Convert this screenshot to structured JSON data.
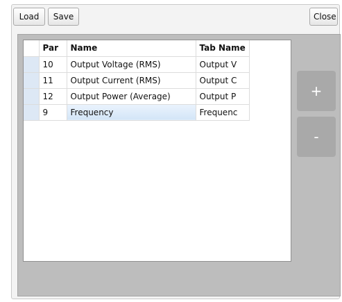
{
  "toolbar": {
    "load_label": "Load",
    "save_label": "Save",
    "close_label": "Close"
  },
  "grid": {
    "columns": [
      "Par",
      "Name",
      "Tab Name"
    ],
    "rows": [
      {
        "par": "10",
        "name": "Output Voltage (RMS)",
        "tab_name": "Output V"
      },
      {
        "par": "11",
        "name": "Output Current (RMS)",
        "tab_name": "Output C"
      },
      {
        "par": "12",
        "name": "Output Power (Average)",
        "tab_name": "Output P"
      },
      {
        "par": "9",
        "name": "Frequency",
        "tab_name": "Frequenc"
      }
    ]
  },
  "side_buttons": {
    "add_label": "+",
    "remove_label": "-"
  },
  "colors": {
    "panel_background": "#bdbdbd",
    "side_button": "#a9a9a9",
    "row_header": "#dde8f5",
    "edit_cell": "#d3e5f7"
  }
}
